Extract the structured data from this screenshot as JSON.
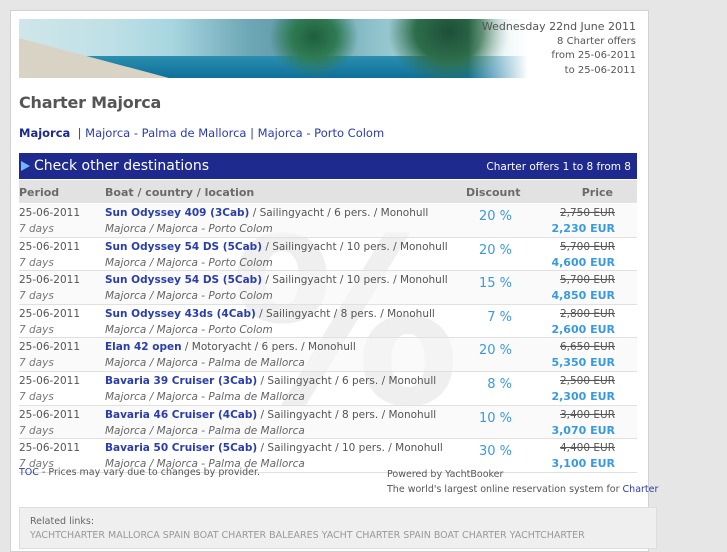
{
  "header": {
    "date": "Wednesday 22nd June 2011",
    "offers": "8 Charter offers",
    "from": "from 25-06-2011",
    "to": "to 25-06-2011"
  },
  "page_title": "Charter Majorca",
  "breadcrumb": {
    "first": "Majorca",
    "second": "Majorca - Palma de Mallorca",
    "third": "Majorca - Porto Colom"
  },
  "bar": {
    "title": "Check other destinations",
    "count": "Charter offers 1 to 8 from 8"
  },
  "columns": {
    "period": "Period",
    "boat": "Boat / country / location",
    "discount": "Discount",
    "price": "Price"
  },
  "watermark": "%",
  "rows": [
    {
      "date": "25-06-2011",
      "days": "7 days",
      "boat": "Sun Odyssey 409 (3Cab)",
      "details": " / Sailingyacht / 6 pers. / Monohull",
      "loc": "Majorca / Majorca - Porto Colom",
      "disc": "20 %",
      "old": "2,750 EUR",
      "new": "2,230 EUR"
    },
    {
      "date": "25-06-2011",
      "days": "7 days",
      "boat": "Sun Odyssey 54 DS (5Cab)",
      "details": " / Sailingyacht / 10 pers. / Monohull",
      "loc": "Majorca / Majorca - Porto Colom",
      "disc": "20 %",
      "old": "5,700 EUR",
      "new": "4,600 EUR"
    },
    {
      "date": "25-06-2011",
      "days": "7 days",
      "boat": "Sun Odyssey 54 DS (5Cab)",
      "details": " / Sailingyacht / 10 pers. / Monohull",
      "loc": "Majorca / Majorca - Porto Colom",
      "disc": "15 %",
      "old": "5,700 EUR",
      "new": "4,850 EUR"
    },
    {
      "date": "25-06-2011",
      "days": "7 days",
      "boat": "Sun Odyssey 43ds (4Cab)",
      "details": " / Sailingyacht / 8 pers. / Monohull",
      "loc": "Majorca / Majorca - Porto Colom",
      "disc": "7 %",
      "old": "2,800 EUR",
      "new": "2,600 EUR"
    },
    {
      "date": "25-06-2011",
      "days": "7 days",
      "boat": "Elan 42 open",
      "details": " / Motoryacht / 6 pers. / Monohull",
      "loc": "Majorca / Majorca - Palma de Mallorca",
      "disc": "20 %",
      "old": "6,650 EUR",
      "new": "5,350 EUR"
    },
    {
      "date": "25-06-2011",
      "days": "7 days",
      "boat": "Bavaria 39 Cruiser (3Cab)",
      "details": " / Sailingyacht / 6 pers. / Monohull",
      "loc": "Majorca / Majorca - Palma de Mallorca",
      "disc": "8 %",
      "old": "2,500 EUR",
      "new": "2,300 EUR"
    },
    {
      "date": "25-06-2011",
      "days": "7 days",
      "boat": "Bavaria 46 Cruiser (4Cab)",
      "details": " / Sailingyacht / 8 pers. / Monohull",
      "loc": "Majorca / Majorca - Palma de Mallorca",
      "disc": "10 %",
      "old": "3,400 EUR",
      "new": "3,070 EUR"
    },
    {
      "date": "25-06-2011",
      "days": "7 days",
      "boat": "Bavaria 50 Cruiser (5Cab)",
      "details": " / Sailingyacht / 10 pers. / Monohull",
      "loc": "Majorca / Majorca - Palma de Mallorca",
      "disc": "30 %",
      "old": "4,400 EUR",
      "new": "3,100 EUR"
    }
  ],
  "footer": {
    "toc": "TOC",
    "note": " - Prices may vary due to changes by provider.",
    "powered": "Powered by YachtBooker",
    "tagline": "The world's largest online reservation system for ",
    "tagline_link": "Charter"
  },
  "related": {
    "label": "Related links:",
    "links": "YACHTCHARTER MALLORCA SPAIN BOAT CHARTER BALEARES YACHT CHARTER SPAIN BOAT CHARTER YACHTCHARTER"
  }
}
